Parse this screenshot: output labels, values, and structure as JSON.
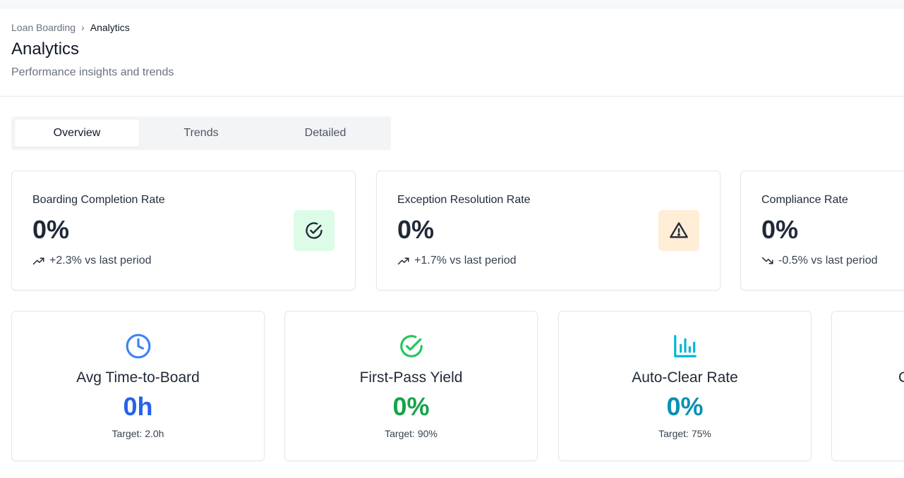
{
  "breadcrumb": {
    "parent": "Loan Boarding",
    "separator": "›",
    "current": "Analytics"
  },
  "page": {
    "title": "Analytics",
    "subtitle": "Performance insights and trends"
  },
  "tabs": [
    {
      "label": "Overview",
      "active": true
    },
    {
      "label": "Trends",
      "active": false
    },
    {
      "label": "Detailed",
      "active": false
    }
  ],
  "kpis": [
    {
      "label": "Boarding Completion Rate",
      "value": "0%",
      "trend": "+2.3% vs last period",
      "trend_dir": "up",
      "icon": "check-circle-icon",
      "icon_bg": "#dcfce7",
      "icon_color": "#15803d"
    },
    {
      "label": "Exception Resolution Rate",
      "value": "0%",
      "trend": "+1.7% vs last period",
      "trend_dir": "up",
      "icon": "warning-triangle-icon",
      "icon_bg": "#ffedd5",
      "icon_color": "#1f2937"
    },
    {
      "label": "Compliance Rate",
      "value": "0%",
      "trend": "-0.5% vs last period",
      "trend_dir": "down",
      "icon": "",
      "icon_bg": "",
      "icon_color": ""
    }
  ],
  "metrics": [
    {
      "label": "Avg Time-to-Board",
      "value": "0h",
      "target": "Target: 2.0h",
      "icon": "clock-icon",
      "color": "#2563eb",
      "icon_color": "#3b82f6"
    },
    {
      "label": "First-Pass Yield",
      "value": "0%",
      "target": "Target: 90%",
      "icon": "check-circle-icon",
      "color": "#16a34a",
      "icon_color": "#22c55e"
    },
    {
      "label": "Auto-Clear Rate",
      "value": "0%",
      "target": "Target: 75%",
      "icon": "bar-chart-icon",
      "color": "#0891b2",
      "icon_color": "#06b6d4"
    },
    {
      "label": "C",
      "value": "",
      "target": "",
      "icon": "",
      "color": "#1f2937",
      "icon_color": ""
    }
  ]
}
